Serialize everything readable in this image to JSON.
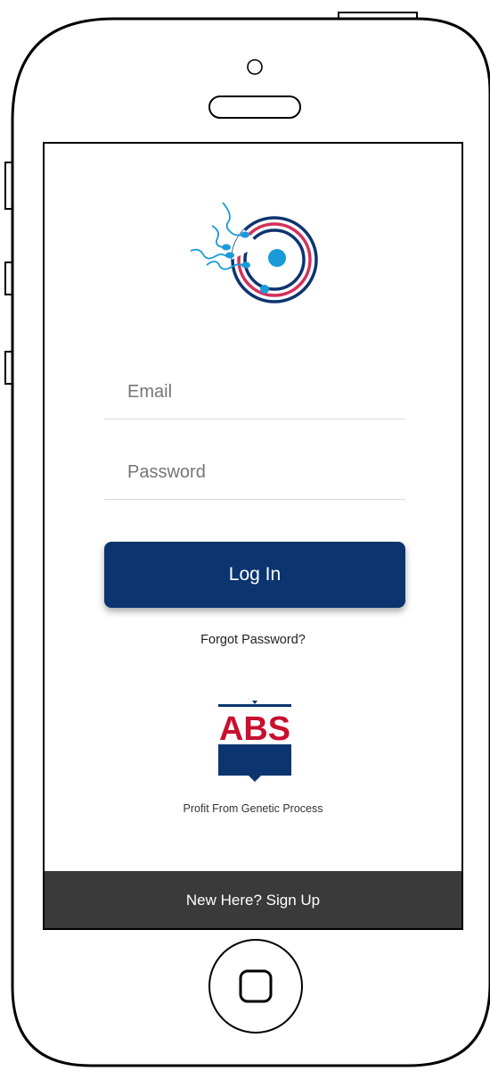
{
  "login": {
    "email_label": "Email",
    "password_label": "Password",
    "login_button": "Log In",
    "forgot_password": "Forgot Password?"
  },
  "brand": {
    "logo_text": "ABS",
    "tagline": "Profit From Genetic Process",
    "primary_color": "#0c3570",
    "accent_color": "#d3305a",
    "highlight_color": "#1a9ad9"
  },
  "footer": {
    "signup_text": "New Here? Sign Up"
  }
}
